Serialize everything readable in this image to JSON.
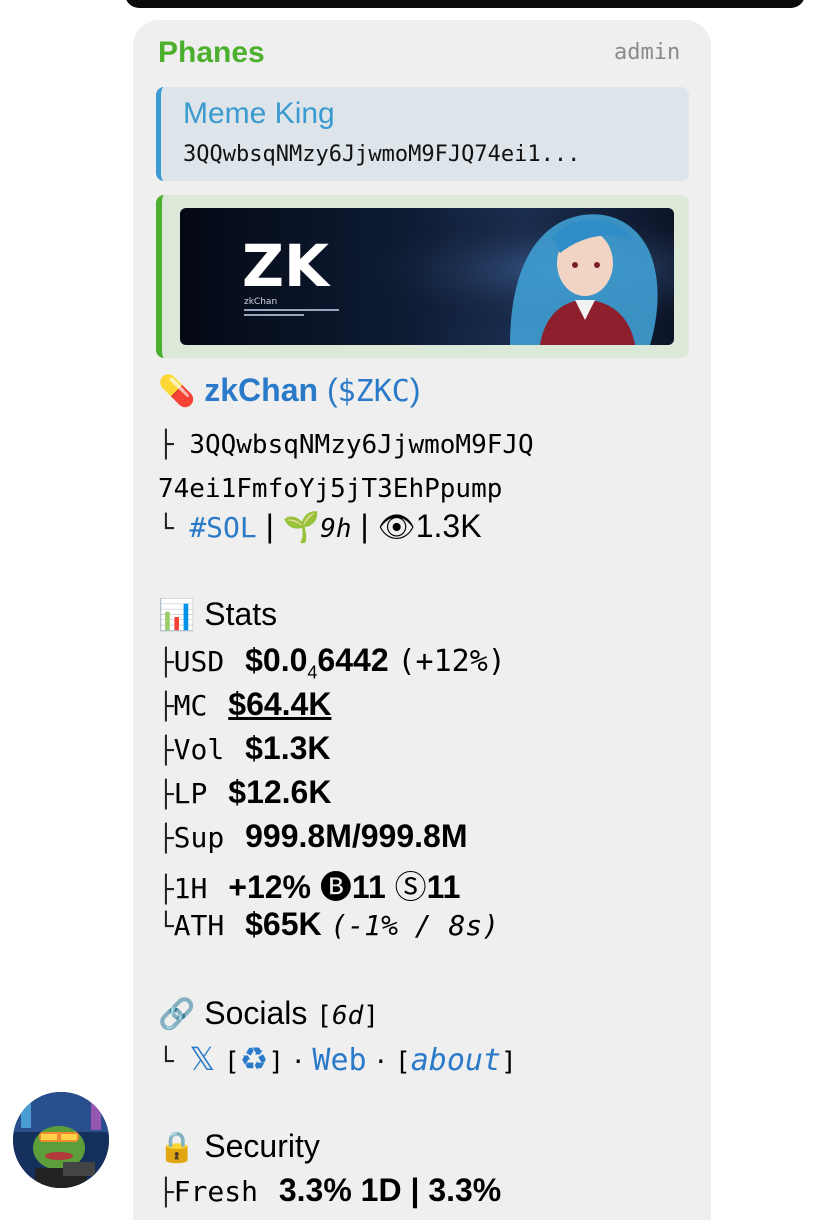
{
  "message": {
    "sender": "Phanes",
    "role": "admin",
    "reply": {
      "title": "Meme King",
      "text": "3QQwbsqNMzy6JjwmoM9FJQ74ei1..."
    },
    "banner": {
      "logo": "ZK",
      "logo_sub": "zkChan"
    },
    "token": {
      "icon": "pill-emoji",
      "name": "zkChan",
      "ticker": "$ZKC",
      "address_line1": "3QQwbsqNMzy6JjwmoM9FJQ",
      "address_line2": "74ei1FmfoYj5jT3EhPpump",
      "chain": "#SOL",
      "age": "9h",
      "views": "1.3K"
    },
    "stats": {
      "icon": "bar-chart-emoji",
      "title": "Stats",
      "usd_label": "USD",
      "usd_value_prefix": "$0.0",
      "usd_value_sub": "4",
      "usd_value_suffix": "6442",
      "usd_change": "(+12%)",
      "mc_label": "MC",
      "mc_value": "$64.4K",
      "vol_label": "Vol",
      "vol_value": "$1.3K",
      "lp_label": "LP",
      "lp_value": "$12.6K",
      "sup_label": "Sup",
      "sup_value": "999.8M/999.8M",
      "h1_label": "1H",
      "h1_change": "+12%",
      "h1_buys": "11",
      "h1_sells": "11",
      "ath_label": "ATH",
      "ath_value": "$65K",
      "ath_detail": "(-1% / 8s)"
    },
    "socials": {
      "icon": "link-emoji",
      "title": "Socials",
      "age": "6d",
      "x_link": "𝕏",
      "web_link": "Web",
      "about_link": "about"
    },
    "security": {
      "icon": "lock-emoji",
      "title": "Security",
      "fresh_label": "Fresh",
      "fresh_value": "3.3% 1D | 3.3%"
    }
  },
  "colors": {
    "sender": "#4caf2e",
    "link": "#2a7ac9",
    "reply_accent": "#3b9ad1",
    "preview_accent": "#4caf2e",
    "bubble": "#efefef"
  }
}
